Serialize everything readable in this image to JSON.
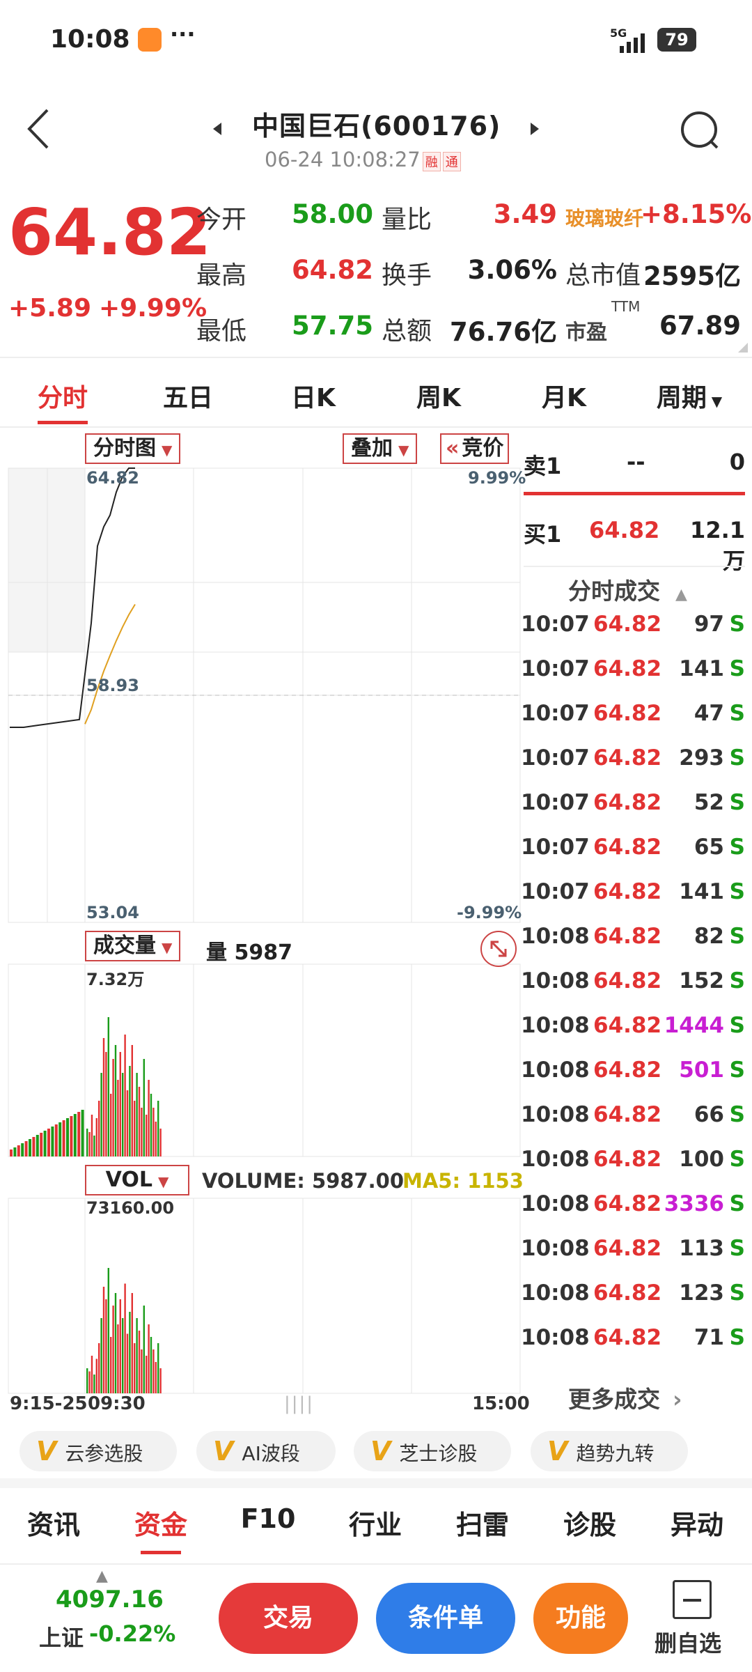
{
  "status_bar": {
    "time": "10:08",
    "more": "···",
    "network": "5G",
    "battery": "79"
  },
  "header": {
    "stock_name": "中国巨石(600176)",
    "datetime": "06-24 10:08:27",
    "tag1": "融",
    "tag2": "通"
  },
  "quote": {
    "price": "64.82",
    "change": "+5.89",
    "change_pct": "+9.99%",
    "open_label": "今开",
    "open": "58.00",
    "high_label": "最高",
    "high": "64.82",
    "low_label": "最低",
    "low": "57.75",
    "vol_ratio_label": "量比",
    "vol_ratio": "3.49",
    "turnover_label": "换手",
    "turnover": "3.06%",
    "amount_label": "总额",
    "amount": "76.76亿",
    "sector_label": "玻璃玻纤",
    "sector_change": "+8.15%",
    "mktcap_label": "总市值",
    "mktcap": "2595亿",
    "pe_label": "市盈",
    "pe_sup": "TTM",
    "pe": "67.89"
  },
  "tabs": [
    "分时",
    "五日",
    "日K",
    "周K",
    "月K",
    "周期"
  ],
  "chart": {
    "type_label": "分时图",
    "overlay_label": "叠加",
    "auction_label": "竞价",
    "price_top": "64.82",
    "price_mid": "58.93",
    "price_bottom": "53.04",
    "pct_top": "9.99%",
    "pct_bottom": "-9.99%",
    "volume_label": "成交量",
    "volume_text": "量 5987",
    "vol_max": "7.32万",
    "vol_indicator": "VOL",
    "vol_readout": "VOLUME: 5987.00",
    "ma5_readout": "MA5: 1153",
    "vol_axis_max": "73160.00",
    "time_start": "9:15-25",
    "time_open": "09:30",
    "time_end": "15:00"
  },
  "chart_data": {
    "type": "line",
    "series": [
      {
        "values": [
          58.1,
          58.1,
          58.15,
          58.2,
          58.25,
          58.3,
          60.8,
          62.8,
          63.3,
          63.6,
          64.2,
          64.6,
          64.82,
          64.82
        ]
      }
    ],
    "yticks": [
      "64.82",
      "58.93",
      "53.04"
    ],
    "xticks": [
      "9:15-25",
      "09:30",
      "15:00"
    ]
  },
  "order_book": {
    "ask1_label": "卖1",
    "ask1_price": "--",
    "ask1_vol": "0",
    "bid1_label": "买1",
    "bid1_price": "64.82",
    "bid1_vol": "12.1万"
  },
  "trades_header": "分时成交",
  "trades": [
    {
      "time": "10:07",
      "price": "64.82",
      "vol": "97",
      "color": "green"
    },
    {
      "time": "10:07",
      "price": "64.82",
      "vol": "141",
      "color": "green"
    },
    {
      "time": "10:07",
      "price": "64.82",
      "vol": "47",
      "color": "green"
    },
    {
      "time": "10:07",
      "price": "64.82",
      "vol": "293",
      "color": "green"
    },
    {
      "time": "10:07",
      "price": "64.82",
      "vol": "52",
      "color": "green"
    },
    {
      "time": "10:07",
      "price": "64.82",
      "vol": "65",
      "color": "green"
    },
    {
      "time": "10:07",
      "price": "64.82",
      "vol": "141",
      "color": "green"
    },
    {
      "time": "10:08",
      "price": "64.82",
      "vol": "82",
      "color": "green"
    },
    {
      "time": "10:08",
      "price": "64.82",
      "vol": "152",
      "color": "green"
    },
    {
      "time": "10:08",
      "price": "64.82",
      "vol": "1444",
      "color": "magenta"
    },
    {
      "time": "10:08",
      "price": "64.82",
      "vol": "501",
      "color": "magenta"
    },
    {
      "time": "10:08",
      "price": "64.82",
      "vol": "66",
      "color": "green"
    },
    {
      "time": "10:08",
      "price": "64.82",
      "vol": "100",
      "color": "green"
    },
    {
      "time": "10:08",
      "price": "64.82",
      "vol": "3336",
      "color": "magenta"
    },
    {
      "time": "10:08",
      "price": "64.82",
      "vol": "113",
      "color": "green"
    },
    {
      "time": "10:08",
      "price": "64.82",
      "vol": "123",
      "color": "green"
    },
    {
      "time": "10:08",
      "price": "64.82",
      "vol": "71",
      "color": "green"
    }
  ],
  "trade_side_label": "S",
  "more_trades": "更多成交",
  "features": [
    "云参选股",
    "AI波段",
    "芝士诊股",
    "趋势九转"
  ],
  "bottom_tabs": [
    "资讯",
    "资金",
    "F10",
    "行业",
    "扫雷",
    "诊股",
    "异动"
  ],
  "index": {
    "value": "4097.16",
    "name": "上证",
    "change": "-0.22%"
  },
  "actions": {
    "trade": "交易",
    "condition": "条件单",
    "function": "功能",
    "remove": "删自选"
  },
  "colors": {
    "up": "#e23232",
    "down": "#1a9c1a",
    "big": "#c81ed2",
    "ma": "#e0a020"
  }
}
